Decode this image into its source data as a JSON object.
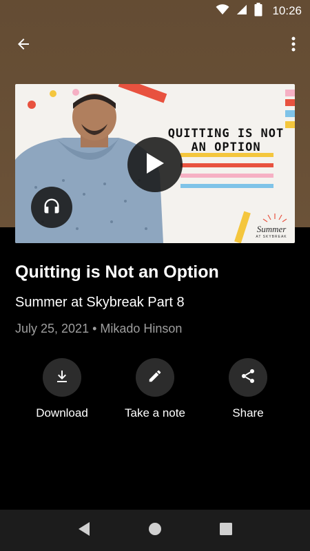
{
  "status_bar": {
    "time": "10:26",
    "icons": [
      "wifi-icon",
      "cell-signal-icon",
      "battery-icon"
    ]
  },
  "app_bar": {
    "back_icon": "arrow-back-icon",
    "menu_icon": "more-vert-icon"
  },
  "media": {
    "thumbnail_title": "QUITTING IS NOT AN OPTION",
    "brand_name": "Summer",
    "brand_sub": "AT SKYBREAK",
    "play_icon": "play-icon",
    "audio_icon": "headphones-icon"
  },
  "sermon": {
    "title": "Quitting is Not an Option",
    "series": "Summer at Skybreak Part 8",
    "date_speaker": "July 25, 2021 • Mikado Hinson"
  },
  "actions": [
    {
      "label": "Download",
      "icon": "download-icon"
    },
    {
      "label": "Take a note",
      "icon": "pencil-icon"
    },
    {
      "label": "Share",
      "icon": "share-icon"
    }
  ],
  "nav_bar": {
    "icons": [
      "nav-back-icon",
      "nav-home-icon",
      "nav-recents-icon"
    ]
  },
  "colors": {
    "header_bg": "#6b5238",
    "page_bg": "#000000",
    "action_circle": "#2c2c2c",
    "meta_text": "#9e9e9e"
  }
}
